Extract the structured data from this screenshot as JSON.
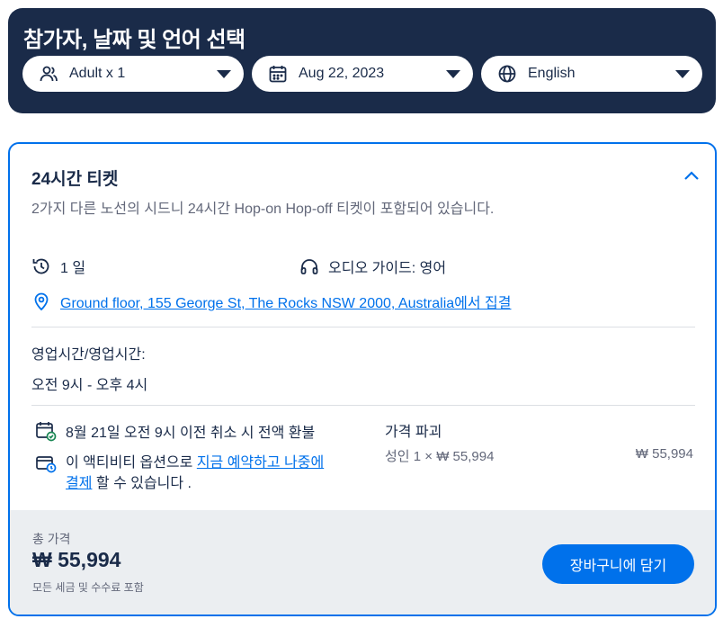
{
  "header": {
    "title": "참가자, 날짜 및 언어 선택",
    "participants": {
      "label": "Adult x 1",
      "icon": "people-icon"
    },
    "date": {
      "label": "Aug 22, 2023",
      "icon": "calendar-icon"
    },
    "language": {
      "label": "English",
      "icon": "globe-icon"
    }
  },
  "option": {
    "title": "24시간 티켓",
    "description": "2가지 다른 노선의 시드니 24시간 Hop-on Hop-off 티켓이 포함되어 있습니다.",
    "duration": "1 일",
    "audio_guide": "오디오 가이드: 영어",
    "meeting_point": "Ground floor, 155 George St, The Rocks NSW 2000, Australia에서 집결",
    "hours_label": "영업시간/영업시간:",
    "hours_value": "오전 9시 - 오후 4시",
    "cancellation": "8월 21일 오전 9시 이전 취소 시 전액 환불",
    "reserve_prefix": "이 액티비티 옵션으로 ",
    "reserve_link": "지금 예약하고 나중에 결제",
    "reserve_suffix": " 할 수 있습니다 .",
    "price_breakdown_title": "가격 파괴",
    "price_line": "성인 1 × ₩ 55,994",
    "price_line_total": "₩ 55,994"
  },
  "footer": {
    "total_label": "총 가격",
    "total_price": "₩ 55,994",
    "tax_note": "모든 세금 및 수수료 포함",
    "cart_button": "장바구니에 담기"
  },
  "colors": {
    "header_bg": "#1a2b49",
    "accent": "#0071eb",
    "footer_bg": "#ebeef1",
    "muted_text": "#63687a"
  }
}
